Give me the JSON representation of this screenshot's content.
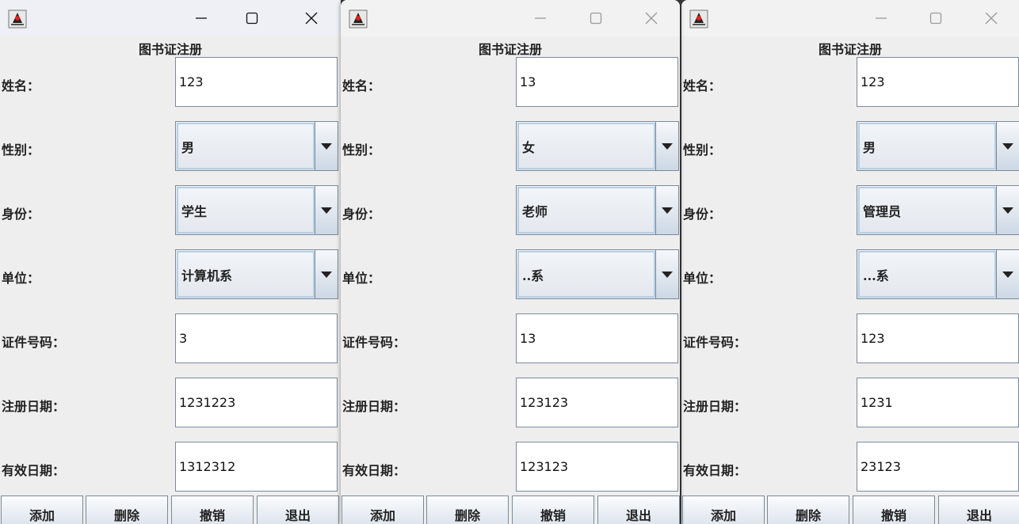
{
  "labels": {
    "title": "图书证注册",
    "name": "姓名：",
    "gender": "性别：",
    "identity": "身份：",
    "unit": "单位：",
    "id_no": "证件号码：",
    "reg_date": "注册日期：",
    "exp_date": "有效日期："
  },
  "buttons": {
    "add": "添加",
    "delete": "删除",
    "cancel": "撤销",
    "exit": "退出"
  },
  "windows": [
    {
      "name": "123",
      "gender": "男",
      "identity": "学生",
      "unit": "计算机系",
      "id_no": "3",
      "reg_date": "1231223",
      "exp_date": "1312312"
    },
    {
      "name": "13",
      "gender": "女",
      "identity": "老师",
      "unit": "..系",
      "id_no": "13",
      "reg_date": "123123",
      "exp_date": "123123"
    },
    {
      "name": "123",
      "gender": "男",
      "identity": "管理员",
      "unit": "...系",
      "id_no": "123",
      "reg_date": "1231",
      "exp_date": "23123"
    }
  ],
  "icons": {
    "app": "java-duke-icon",
    "minimize": "minimize-icon",
    "maximize": "maximize-icon",
    "close": "close-icon",
    "dropdown": "chevron-down-icon"
  }
}
